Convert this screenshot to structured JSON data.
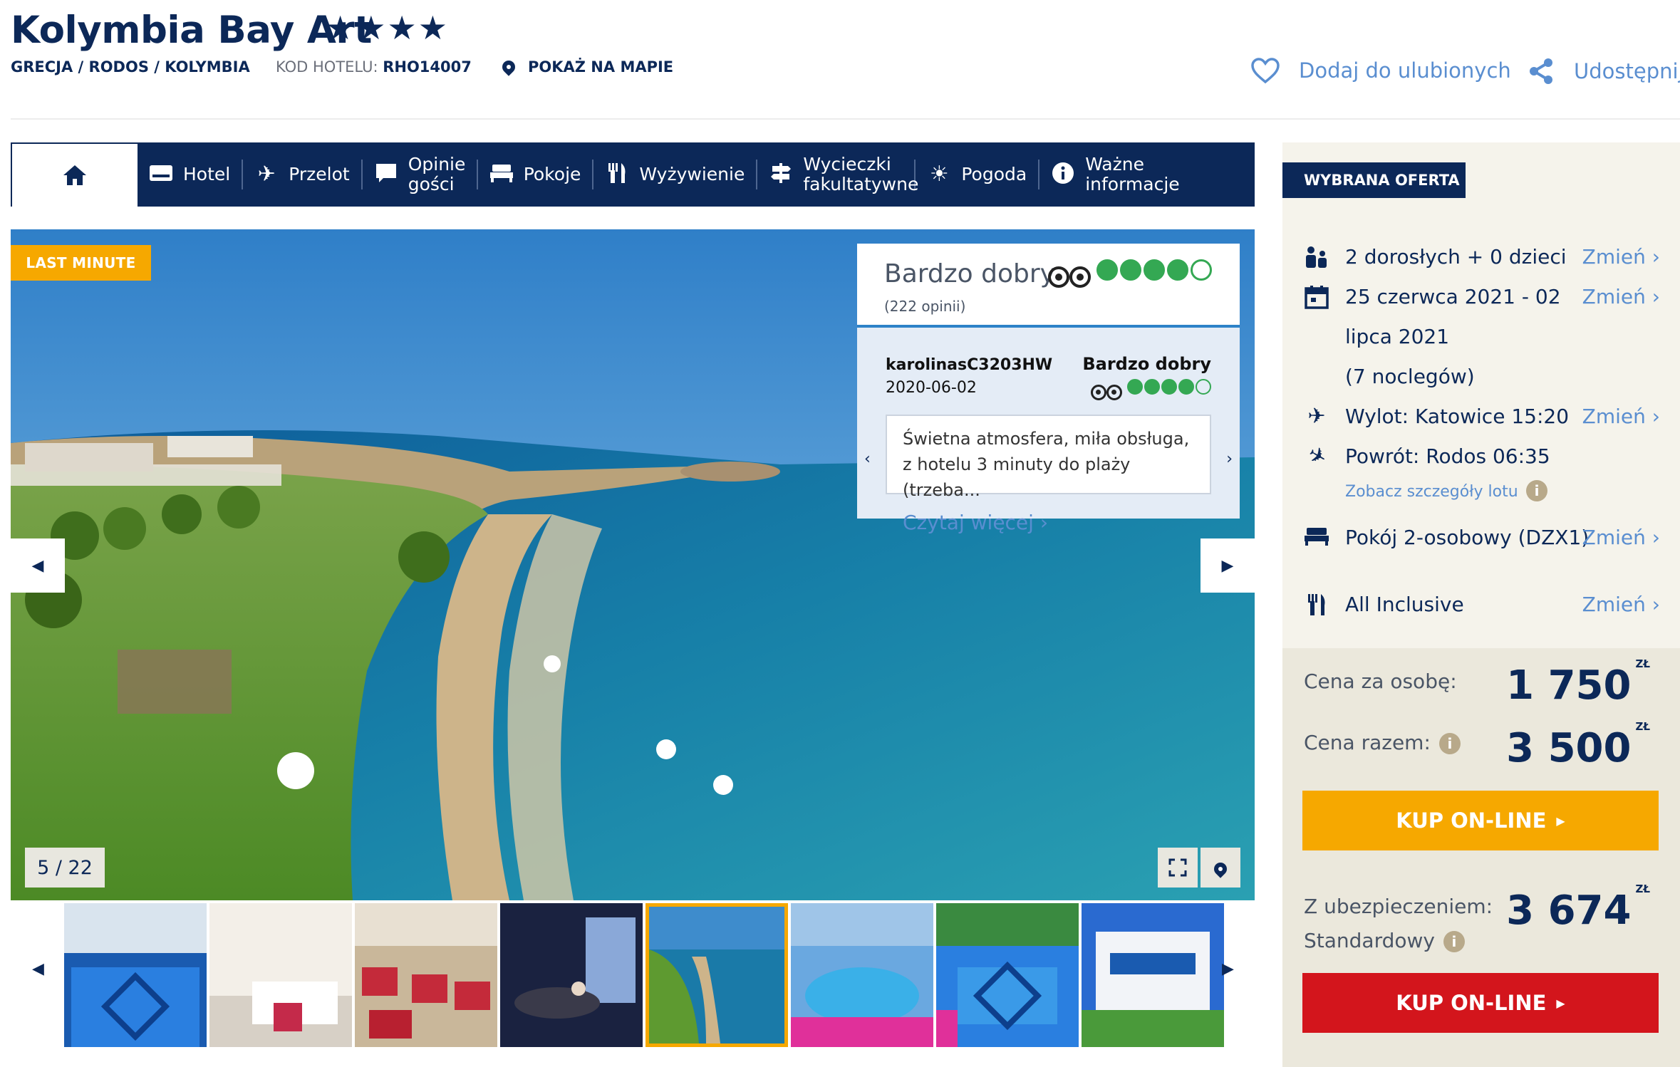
{
  "hotel": {
    "name": "Kolymbia Bay Art",
    "stars": "★★★★",
    "location": "GRECJA / RODOS / KOLYMBIA",
    "code_label": "KOD HOTELU:",
    "code_value": "RHO14007",
    "map_link": "POKAŻ NA MAPIE"
  },
  "actions": {
    "favorite": "Dodaj do ulubionych",
    "share": "Udostępnij"
  },
  "nav": {
    "items": [
      {
        "label": "Hotel",
        "icon": "hotel-icon"
      },
      {
        "label": "Przelot",
        "icon": "plane-icon"
      },
      {
        "label": "Opinie gości",
        "icon": "comment-icon"
      },
      {
        "label": "Pokoje",
        "icon": "bed-icon"
      },
      {
        "label": "Wyżywienie",
        "icon": "fork-knife-icon"
      },
      {
        "label": "Wycieczki fakultatywne",
        "icon": "signpost-icon"
      },
      {
        "label": "Pogoda",
        "icon": "sun-icon"
      },
      {
        "label": "Ważne informacje",
        "icon": "info-icon"
      }
    ]
  },
  "gallery": {
    "badge": "LAST MINUTE",
    "counter": "5 / 22",
    "current": 5,
    "total": 22
  },
  "review": {
    "overall": "Bardzo dobry",
    "count": "(222 opinii)",
    "overall_rating": 4,
    "user": "karolinasC3203HW",
    "date": "2020-06-02",
    "user_grade": "Bardzo dobry",
    "user_rating": 4,
    "text": "Świetna atmosfera, miła obsługa, z hotelu 3 minuty do plaży (trzeba...",
    "more": "Czytaj więcej"
  },
  "offer": {
    "heading": "WYBRANA OFERTA",
    "change_label": "Zmień",
    "guests": "2 dorosłych + 0 dzieci",
    "dates_line1": "25 czerwca 2021 - 02",
    "dates_line2": "lipca 2021",
    "nights": "(7 noclegów)",
    "departure": "Wylot: Katowice 15:20",
    "return": "Powrót: Rodos 06:35",
    "flight_details": "Zobacz szczegóły lotu",
    "room": "Pokój 2-osobowy (DZX1)",
    "board": "All Inclusive",
    "price_person_label": "Cena za osobę:",
    "price_person": "1 750",
    "price_total_label": "Cena razem:",
    "price_total": "3 500",
    "currency": "ZŁ",
    "buy_label": "KUP ON-LINE",
    "insurance_label1": "Z ubezpieczeniem:",
    "insurance_label2": "Standardowy",
    "price_insured": "3 674"
  }
}
